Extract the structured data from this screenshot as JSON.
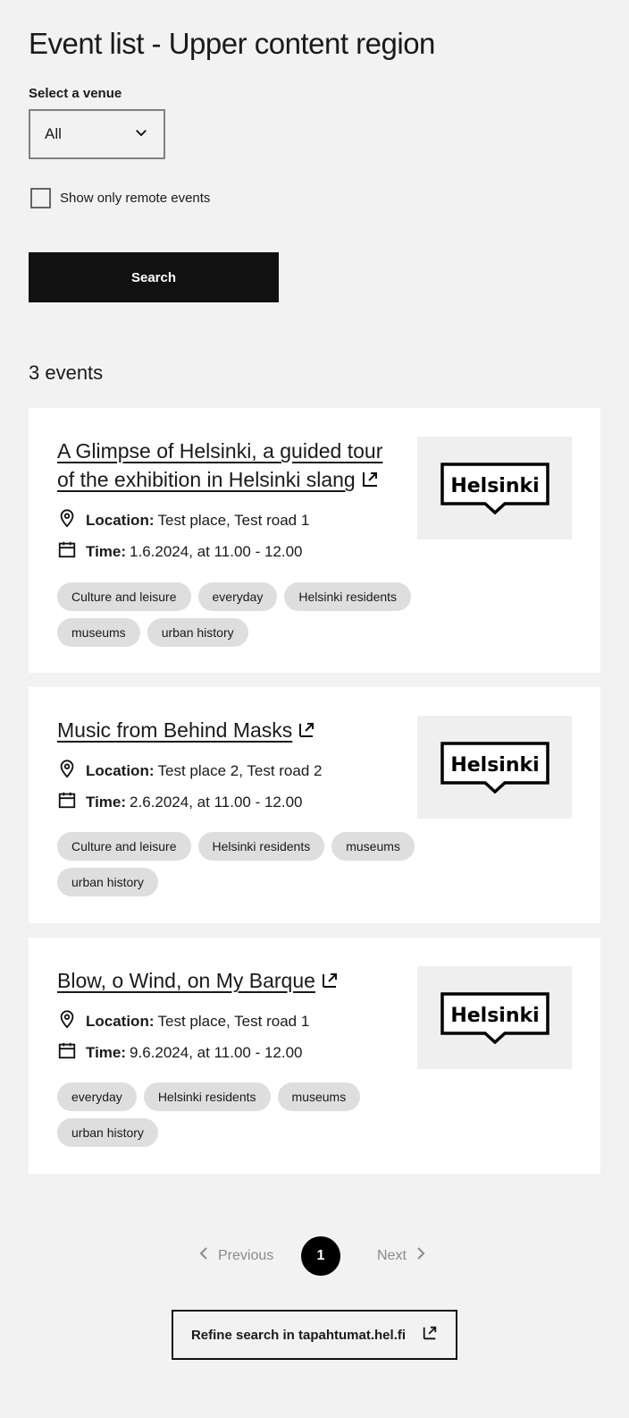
{
  "page_title": "Event list - Upper content region",
  "venue": {
    "label": "Select a venue",
    "selected": "All"
  },
  "remote_filter": {
    "label": "Show only remote events",
    "checked": false
  },
  "search_button": "Search",
  "result_count": "3 events",
  "events": [
    {
      "title": "A Glimpse of Helsinki, a guided tour of the exhibition in Helsinki slang",
      "location_label": "Location:",
      "location": "Test place, Test road 1",
      "time_label": "Time:",
      "time": "1.6.2024, at 11.00 - 12.00",
      "image_text": "Helsinki",
      "tags": [
        "Culture and leisure",
        "everyday",
        "Helsinki residents",
        "museums",
        "urban history"
      ]
    },
    {
      "title": "Music from Behind Masks",
      "location_label": "Location:",
      "location": "Test place 2, Test road 2",
      "time_label": "Time:",
      "time": "2.6.2024, at 11.00 - 12.00",
      "image_text": "Helsinki",
      "tags": [
        "Culture and leisure",
        "Helsinki residents",
        "museums",
        "urban history"
      ]
    },
    {
      "title": "Blow, o Wind, on My Barque",
      "location_label": "Location:",
      "location": "Test place, Test road 1",
      "time_label": "Time:",
      "time": "9.6.2024, at 11.00 - 12.00",
      "image_text": "Helsinki",
      "tags": [
        "everyday",
        "Helsinki residents",
        "museums",
        "urban history"
      ]
    }
  ],
  "pagination": {
    "previous": "Previous",
    "current": "1",
    "next": "Next"
  },
  "refine_link": "Refine search in tapahtumat.hel.fi"
}
